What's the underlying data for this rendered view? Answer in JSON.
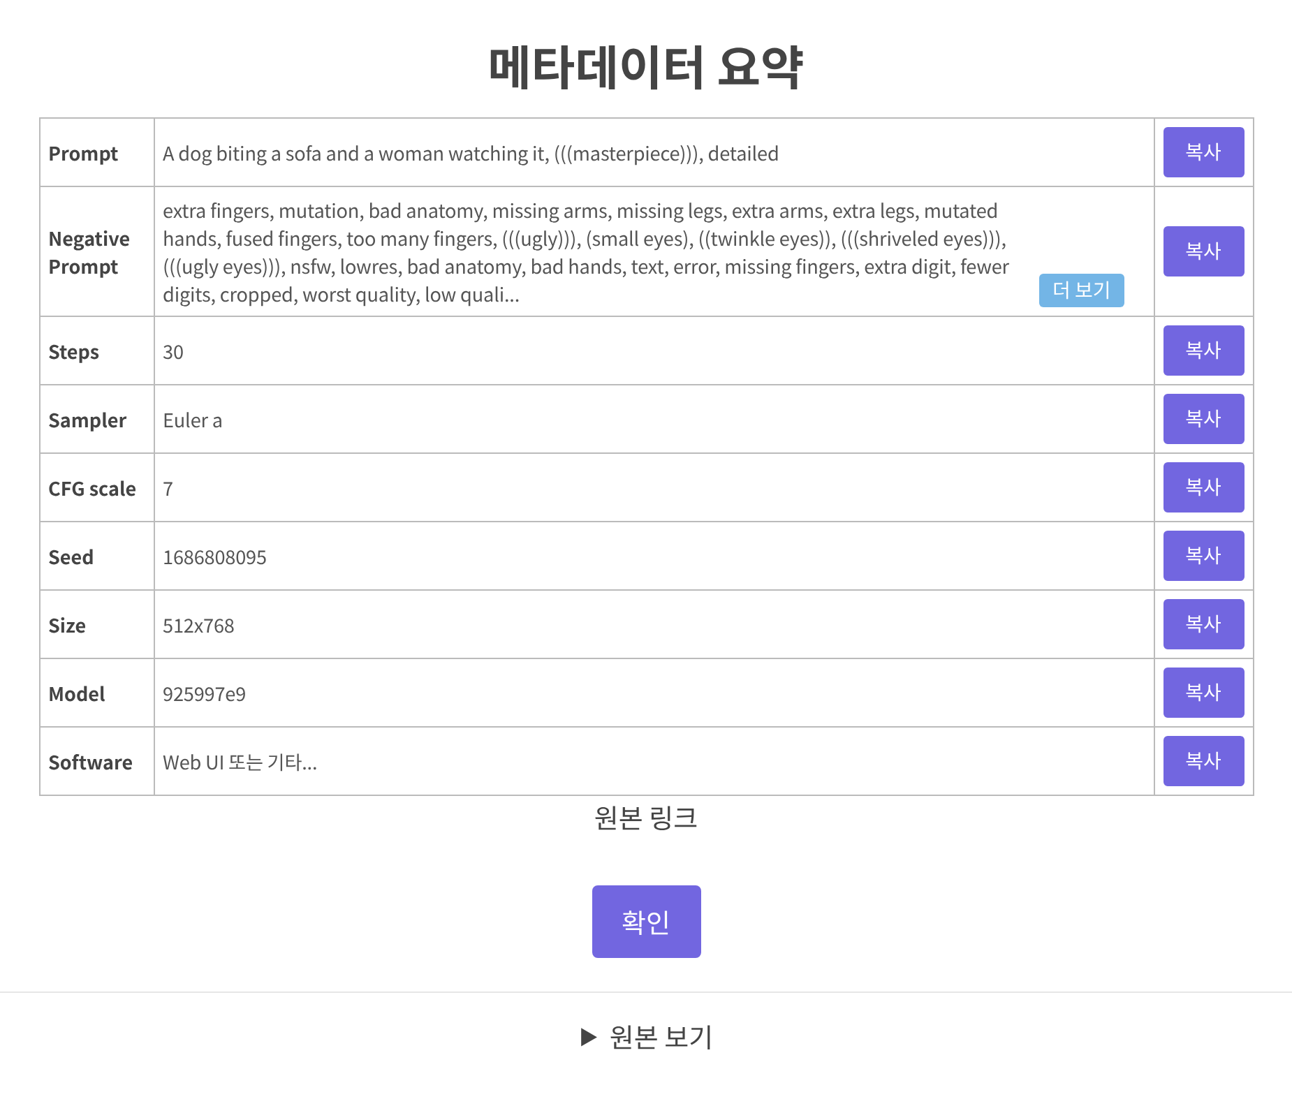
{
  "title": "메타데이터 요약",
  "rows": [
    {
      "label": "Prompt",
      "value": "A dog biting a sofa and a woman watching it, (((masterpiece))), detailed",
      "copy": "복사"
    },
    {
      "label": "Negative Prompt",
      "value": "extra fingers, mutation, bad anatomy, missing arms, missing legs, extra arms, extra legs, mutated hands, fused fingers, too many fingers, (((ugly))), (small eyes), ((twinkle eyes)), (((shriveled eyes))), (((ugly eyes))), nsfw, lowres, bad anatomy, bad hands, text, error, missing fingers, extra digit, fewer digits, cropped, worst quality, low quali...",
      "more": "더 보기",
      "copy": "복사"
    },
    {
      "label": "Steps",
      "value": "30",
      "copy": "복사"
    },
    {
      "label": "Sampler",
      "value": "Euler a",
      "copy": "복사"
    },
    {
      "label": "CFG scale",
      "value": "7",
      "copy": "복사"
    },
    {
      "label": "Seed",
      "value": "1686808095",
      "copy": "복사"
    },
    {
      "label": "Size",
      "value": "512x768",
      "copy": "복사"
    },
    {
      "label": "Model",
      "value": "925997e9",
      "copy": "복사"
    },
    {
      "label": "Software",
      "value": "Web UI 또는 기타...",
      "copy": "복사"
    }
  ],
  "source_link": "원본 링크",
  "confirm": "확인",
  "details": {
    "marker": "▶",
    "summary": "원본 보기",
    "expanded": false
  }
}
